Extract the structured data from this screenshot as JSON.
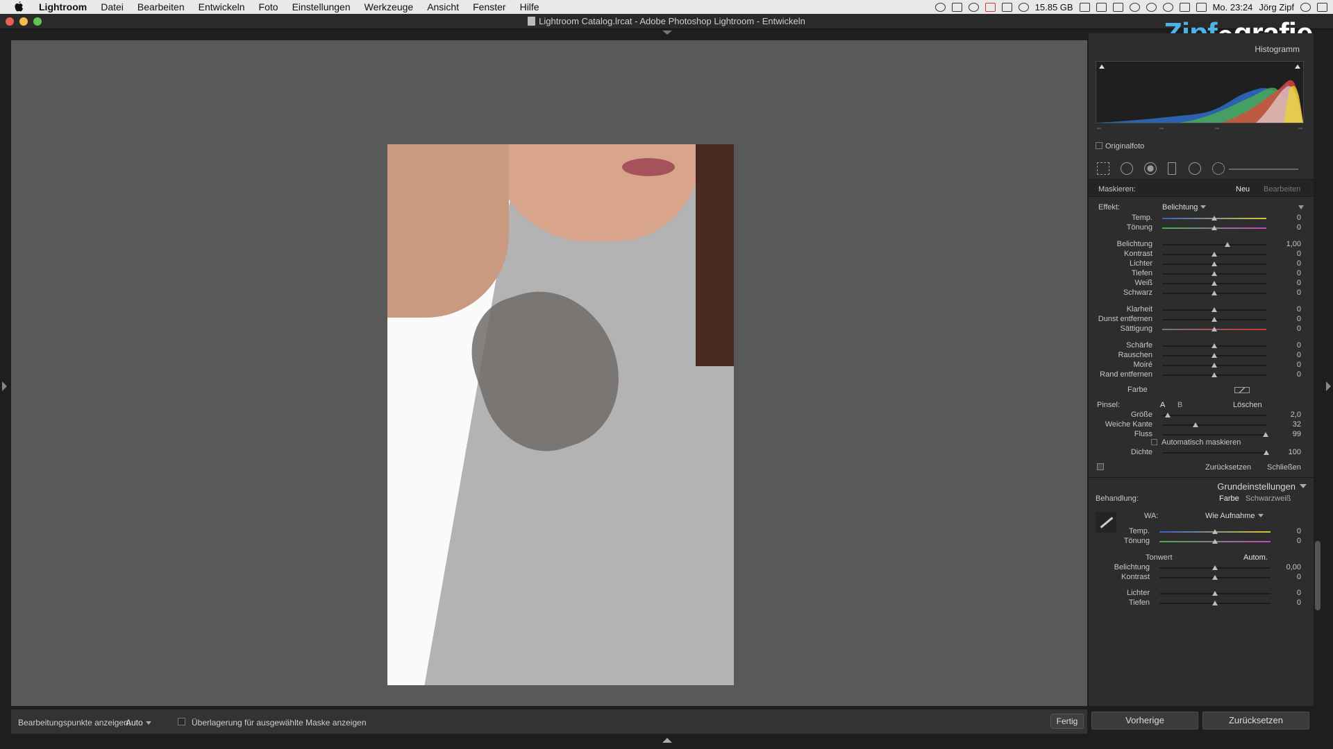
{
  "menubar": {
    "items": [
      "Lightroom",
      "Datei",
      "Bearbeiten",
      "Entwickeln",
      "Foto",
      "Einstellungen",
      "Werkzeuge",
      "Ansicht",
      "Fenster",
      "Hilfe"
    ],
    "storage": "15.85 GB",
    "clock": "Mo. 23:24",
    "user": "Jörg Zipf"
  },
  "window": {
    "title": "Lightroom Catalog.lrcat - Adobe Photoshop Lightroom - Entwickeln"
  },
  "logo": {
    "part1": "Zipf",
    "part2": "grafie"
  },
  "toolbar": {
    "show_points_label": "Bearbeitungspunkte anzeigen:",
    "show_points_value": "Auto",
    "overlay_label": "Überlagerung für ausgewählte Maske anzeigen",
    "done_button": "Fertig"
  },
  "panel": {
    "histogram_title": "Histogramm",
    "histogram_labels": [
      "–",
      "–",
      "–",
      "–"
    ],
    "original_photo": "Originalfoto",
    "mask": {
      "label": "Maskieren:",
      "new": "Neu",
      "edit": "Bearbeiten"
    },
    "effect": {
      "label": "Effekt:",
      "value": "Belichtung"
    },
    "sliders": [
      {
        "label": "Temp.",
        "value": "0",
        "pos": 0.5,
        "group": 0
      },
      {
        "label": "Tönung",
        "value": "0",
        "pos": 0.5,
        "group": 0
      },
      {
        "label": "Belichtung",
        "value": "1,00",
        "pos": 0.625,
        "group": 1
      },
      {
        "label": "Kontrast",
        "value": "0",
        "pos": 0.5,
        "group": 1
      },
      {
        "label": "Lichter",
        "value": "0",
        "pos": 0.5,
        "group": 1
      },
      {
        "label": "Tiefen",
        "value": "0",
        "pos": 0.5,
        "group": 1
      },
      {
        "label": "Weiß",
        "value": "0",
        "pos": 0.5,
        "group": 1
      },
      {
        "label": "Schwarz",
        "value": "0",
        "pos": 0.5,
        "group": 1
      },
      {
        "label": "Klarheit",
        "value": "0",
        "pos": 0.5,
        "group": 2
      },
      {
        "label": "Dunst entfernen",
        "value": "0",
        "pos": 0.5,
        "group": 2
      },
      {
        "label": "Sättigung",
        "value": "0",
        "pos": 0.5,
        "group": 2
      },
      {
        "label": "Schärfe",
        "value": "0",
        "pos": 0.5,
        "group": 3
      },
      {
        "label": "Rauschen",
        "value": "0",
        "pos": 0.5,
        "group": 3
      },
      {
        "label": "Moiré",
        "value": "0",
        "pos": 0.5,
        "group": 3
      },
      {
        "label": "Rand entfernen",
        "value": "0",
        "pos": 0.5,
        "group": 3
      }
    ],
    "color_label": "Farbe",
    "brush": {
      "label": "Pinsel:",
      "a": "A",
      "b": "B",
      "erase": "Löschen"
    },
    "brush_sliders": [
      {
        "label": "Größe",
        "value": "2,0",
        "pos": 0.05
      },
      {
        "label": "Weiche Kante",
        "value": "32",
        "pos": 0.32
      },
      {
        "label": "Fluss",
        "value": "99",
        "pos": 0.99
      }
    ],
    "auto_mask": "Automatisch maskieren",
    "density": {
      "label": "Dichte",
      "value": "100",
      "pos": 1.0
    },
    "mask_reset": "Zurücksetzen",
    "mask_close": "Schließen",
    "basic": {
      "title": "Grundeinstellungen",
      "treatment_label": "Behandlung:",
      "treatment_color": "Farbe",
      "treatment_bw": "Schwarzweiß",
      "wb_label": "WA:",
      "wb_value": "Wie Aufnahme",
      "wb_sliders": [
        {
          "label": "Temp.",
          "value": "0",
          "pos": 0.5
        },
        {
          "label": "Tönung",
          "value": "0",
          "pos": 0.5
        }
      ],
      "tone_label": "Tonwert",
      "tone_auto": "Autom.",
      "tone_sliders": [
        {
          "label": "Belichtung",
          "value": "0,00",
          "pos": 0.5
        },
        {
          "label": "Kontrast",
          "value": "0",
          "pos": 0.5
        },
        {
          "label": "Lichter",
          "value": "0",
          "pos": 0.5
        },
        {
          "label": "Tiefen",
          "value": "0",
          "pos": 0.5
        }
      ]
    },
    "prev_button": "Vorherige",
    "reset_button": "Zurücksetzen"
  },
  "colors": {
    "accent": "#4fb2e6",
    "panel": "#2d2d2d",
    "canvas": "#595959"
  }
}
